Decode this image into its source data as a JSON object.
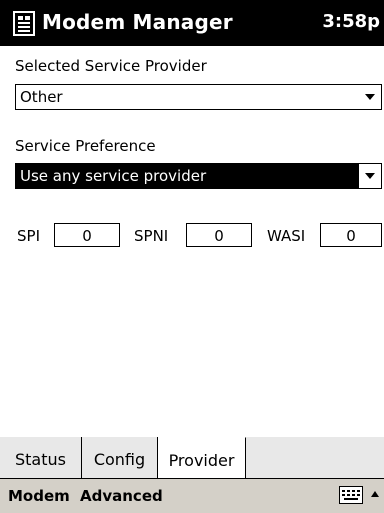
{
  "titlebar": {
    "title": "Modem Manager",
    "time": "3:58p",
    "icon": "modem-manager-icon"
  },
  "provider": {
    "label": "Selected Service Provider",
    "value": "Other"
  },
  "preference": {
    "label": "Service Preference",
    "value": "Use any service provider"
  },
  "fields": {
    "spi_label": "SPI",
    "spi_value": "0",
    "spni_label": "SPNI",
    "spni_value": "0",
    "wasi_label": "WASI",
    "wasi_value": "0"
  },
  "tabs": [
    {
      "label": "Status",
      "active": false
    },
    {
      "label": "Config",
      "active": false
    },
    {
      "label": "Provider",
      "active": true
    }
  ],
  "menubar": {
    "modem": "Modem",
    "advanced": "Advanced",
    "keyboard_icon": "keyboard-icon",
    "arrow_icon": "up-arrow-icon",
    "background": "#d4d0c8"
  }
}
